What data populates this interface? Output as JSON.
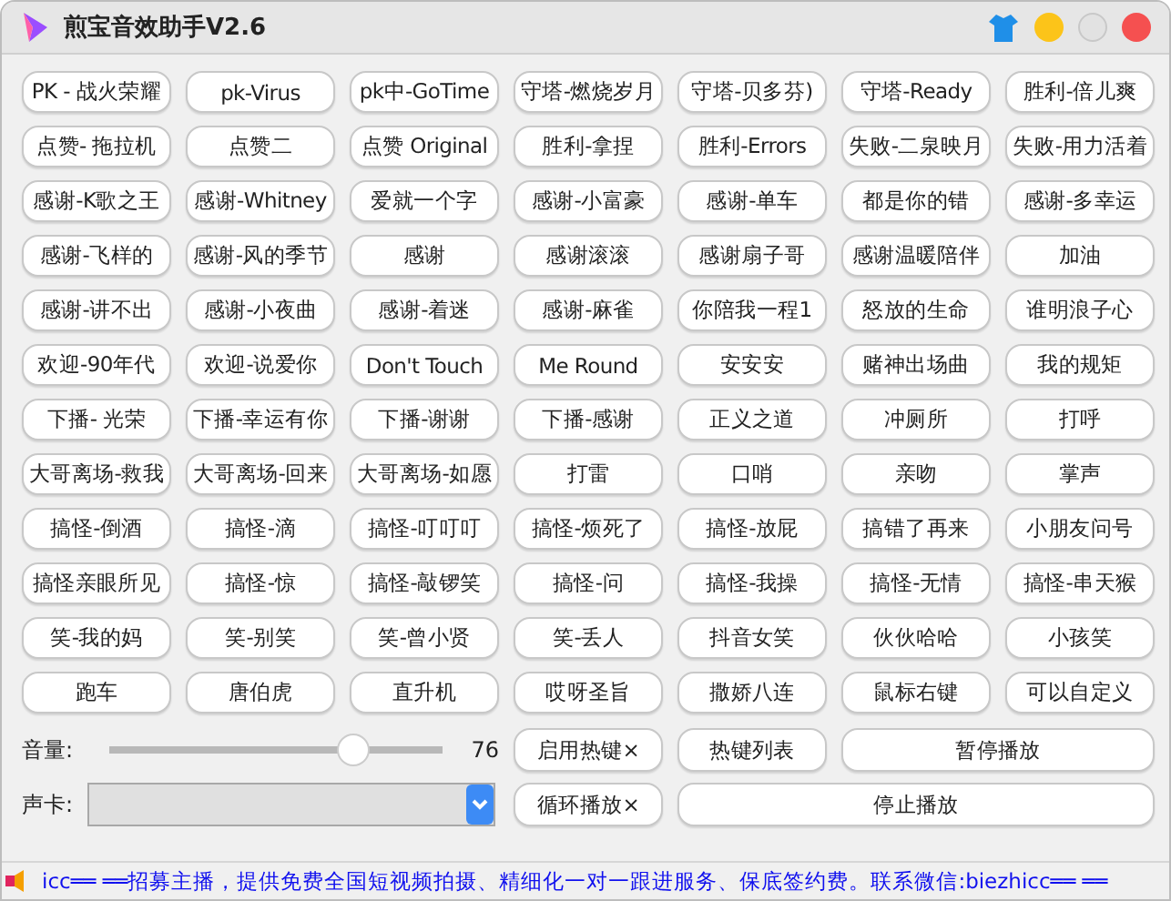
{
  "window": {
    "title": "煎宝音效助手V2.6"
  },
  "sound_buttons": [
    [
      "PK - 战火荣耀",
      "pk-Virus",
      "pk中-GoTime",
      "守塔-燃烧岁月",
      "守塔-贝多芬)",
      "守塔-Ready",
      "胜利-倍儿爽"
    ],
    [
      "点赞- 拖拉机",
      "点赞二",
      "点赞 Original",
      "胜利-拿捏",
      "胜利-Errors",
      "失败-二泉映月",
      "失败-用力活着"
    ],
    [
      "感谢-K歌之王",
      "感谢-Whitney",
      "爱就一个字",
      "感谢-小富豪",
      "感谢-单车",
      "都是你的错",
      "感谢-多幸运"
    ],
    [
      "感谢-飞样的",
      "感谢-风的季节",
      "感谢",
      "感谢滚滚",
      "感谢扇子哥",
      "感谢温暖陪伴",
      "加油"
    ],
    [
      "感谢-讲不出",
      "感谢-小夜曲",
      "感谢-着迷",
      "感谢-麻雀",
      "你陪我一程1",
      "怒放的生命",
      "谁明浪子心"
    ],
    [
      "欢迎-90年代",
      "欢迎-说爱你",
      "Don't Touch",
      "Me Round",
      "安安安",
      "赌神出场曲",
      "我的规矩"
    ],
    [
      "下播- 光荣",
      "下播-幸运有你",
      "下播-谢谢",
      "下播-感谢",
      "正义之道",
      "冲厕所",
      "打呼"
    ],
    [
      "大哥离场-救我",
      "大哥离场-回来",
      "大哥离场-如愿",
      "打雷",
      "口哨",
      "亲吻",
      "掌声"
    ],
    [
      "搞怪-倒酒",
      "搞怪-滴",
      "搞怪-叮叮叮",
      "搞怪-烦死了",
      "搞怪-放屁",
      "搞错了再来",
      "小朋友问号"
    ],
    [
      "搞怪亲眼所见",
      "搞怪-惊",
      "搞怪-敲锣笑",
      "搞怪-问",
      "搞怪-我操",
      "搞怪-无情",
      "搞怪-串天猴"
    ],
    [
      "笑-我的妈",
      "笑-别笑",
      "笑-曾小贤",
      "笑-丢人",
      "抖音女笑",
      "伙伙哈哈",
      "小孩笑"
    ],
    [
      "跑车",
      "唐伯虎",
      "直升机",
      "哎呀圣旨",
      "撒娇八连",
      "鼠标右键",
      "可以自定义"
    ]
  ],
  "volume": {
    "label": "音量:",
    "level": 0.76,
    "reading": "76"
  },
  "sound_card": {
    "label": "声卡:"
  },
  "hotkey_toggle": "启用热键×",
  "hotkey_list": "热键列表",
  "pause": "暂停播放",
  "loop_toggle": "循环播放×",
  "stop": "停止播放",
  "status_bar": {
    "text": "icc══ ══招募主播，提供免费全国短视频拍摄、精细化一对一跟进服务、保底签约费。联系微信:biezhicc══ ══"
  }
}
